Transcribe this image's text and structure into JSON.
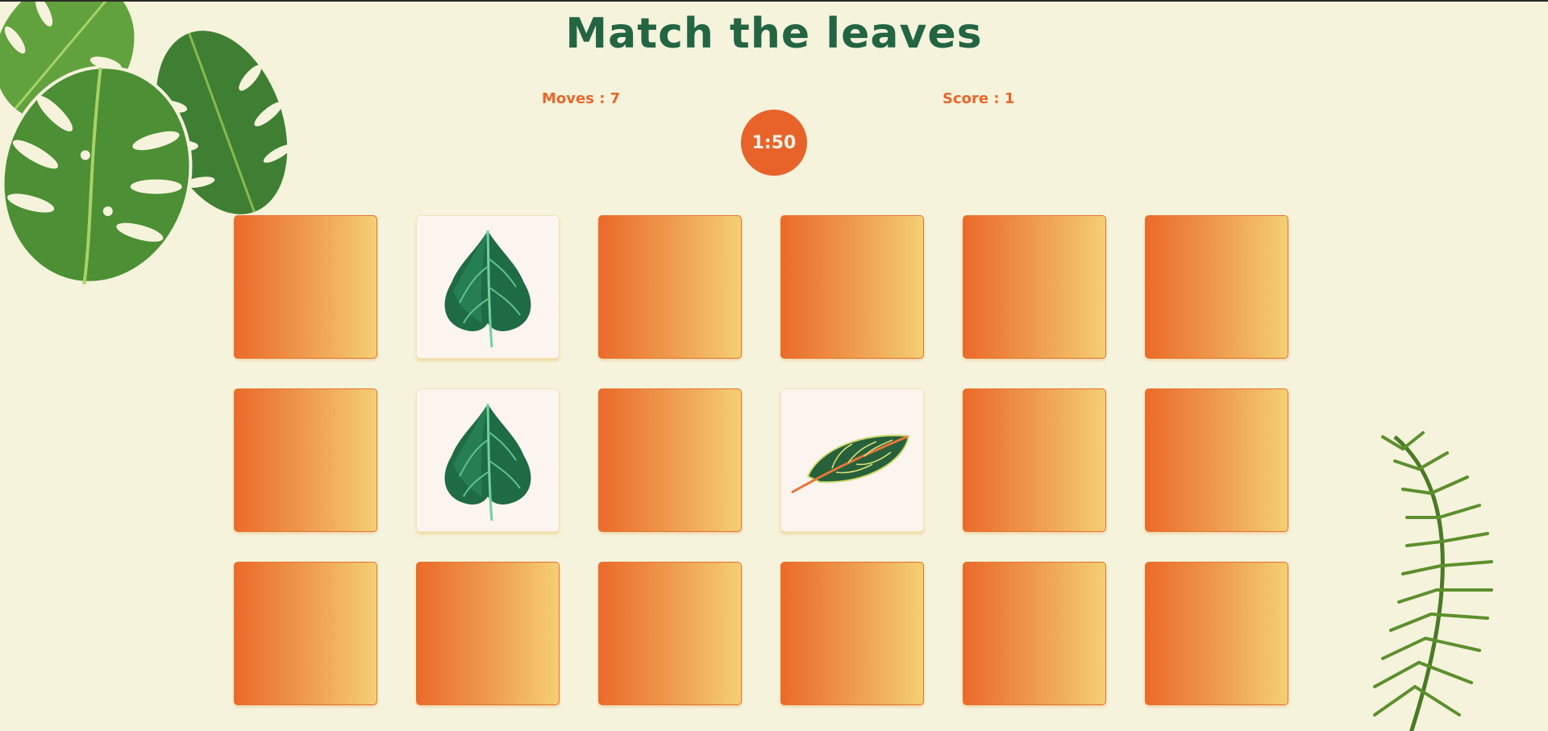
{
  "game": {
    "title": "Match the leaves",
    "moves_label": "Moves : 7",
    "score_label": "Score : 1",
    "timer": "1:50"
  },
  "colors": {
    "background": "#f5f3dc",
    "title": "#236543",
    "accent": "#e8632a",
    "card_back_start": "#eb6a2a",
    "card_back_end": "#f5cf74",
    "card_face": "#fcf4ee"
  },
  "board": {
    "columns": 6,
    "rows": 3,
    "cards": [
      {
        "state": "hidden"
      },
      {
        "state": "revealed",
        "icon": "heart-leaf-icon"
      },
      {
        "state": "hidden"
      },
      {
        "state": "hidden"
      },
      {
        "state": "hidden"
      },
      {
        "state": "hidden"
      },
      {
        "state": "hidden"
      },
      {
        "state": "revealed",
        "icon": "heart-leaf-icon"
      },
      {
        "state": "hidden"
      },
      {
        "state": "revealed",
        "icon": "croton-leaf-icon"
      },
      {
        "state": "hidden"
      },
      {
        "state": "hidden"
      },
      {
        "state": "hidden"
      },
      {
        "state": "hidden"
      },
      {
        "state": "hidden"
      },
      {
        "state": "hidden"
      },
      {
        "state": "hidden"
      },
      {
        "state": "hidden"
      }
    ]
  },
  "decorations": [
    "monstera-leaves-icon",
    "fern-frond-icon"
  ]
}
